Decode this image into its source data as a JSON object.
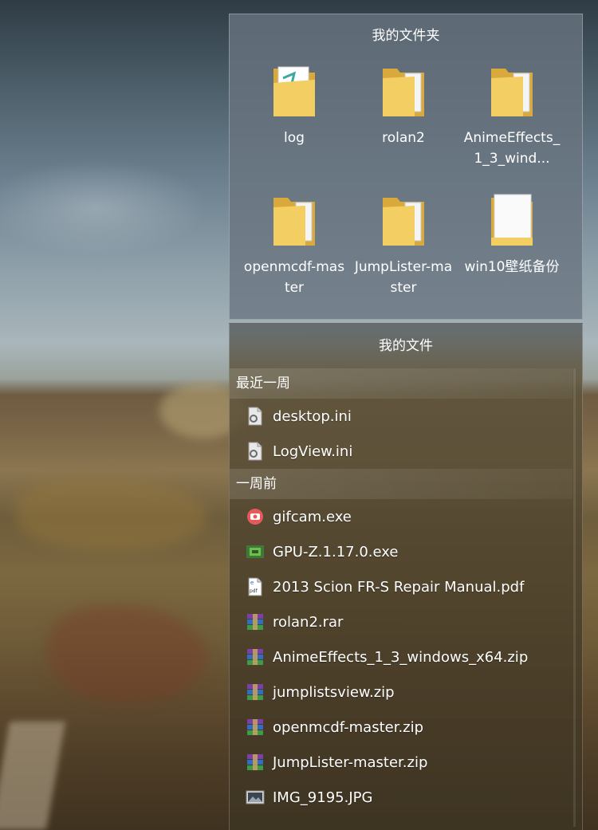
{
  "folders_panel": {
    "title": "我的文件夹",
    "items": [
      {
        "label": "log",
        "icon": "folder-icon"
      },
      {
        "label": "rolan2",
        "icon": "folder-icon"
      },
      {
        "label": "AnimeEffects_1_3_wind...",
        "icon": "folder-icon"
      },
      {
        "label": "openmcdf-master",
        "icon": "folder-icon"
      },
      {
        "label": "JumpLister-master",
        "icon": "folder-icon"
      },
      {
        "label": "win10壁纸备份",
        "icon": "folder-icon"
      }
    ]
  },
  "files_panel": {
    "title": "我的文件",
    "sections": [
      {
        "header": "最近一周",
        "items": [
          {
            "name": "desktop.ini",
            "icon": "ini-file-icon"
          },
          {
            "name": "LogView.ini",
            "icon": "ini-file-icon"
          }
        ]
      },
      {
        "header": "一周前",
        "items": [
          {
            "name": "gifcam.exe",
            "icon": "gifcam-icon"
          },
          {
            "name": "GPU-Z.1.17.0.exe",
            "icon": "gpuz-icon"
          },
          {
            "name": "2013 Scion FR-S Repair Manual.pdf",
            "icon": "pdf-file-icon"
          },
          {
            "name": "rolan2.rar",
            "icon": "archive-icon"
          },
          {
            "name": "AnimeEffects_1_3_windows_x64.zip",
            "icon": "archive-icon"
          },
          {
            "name": "jumplistsview.zip",
            "icon": "archive-icon"
          },
          {
            "name": "openmcdf-master.zip",
            "icon": "archive-icon"
          },
          {
            "name": "JumpLister-master.zip",
            "icon": "archive-icon"
          },
          {
            "name": "IMG_9195.JPG",
            "icon": "image-file-icon"
          }
        ]
      }
    ]
  },
  "colors": {
    "folder_yellow": "#f3cf63",
    "folder_dark": "#d9a93c",
    "panel_text": "#ffffff"
  }
}
